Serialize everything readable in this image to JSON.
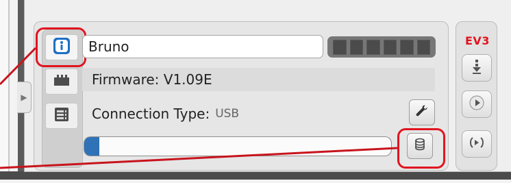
{
  "brick": {
    "name": "Bruno",
    "firmware_label": "Firmware: V1.09E",
    "connection_label": "Connection Type:",
    "connection_value": "USB",
    "status_cells": 6,
    "progress_fraction": 0.05
  },
  "ev3": {
    "logo_text": "EV3"
  },
  "icons": {
    "info": "info-icon",
    "castle": "ports-icon",
    "list": "list-icon",
    "wrench": "wrench-icon",
    "database": "memory-icon",
    "download": "download-icon",
    "play": "play-icon",
    "play_selected": "run-selected-icon"
  },
  "colors": {
    "accent_red": "#e0141f",
    "progress_blue": "#2f72b8",
    "meter_dark": "#4b4b4b"
  }
}
